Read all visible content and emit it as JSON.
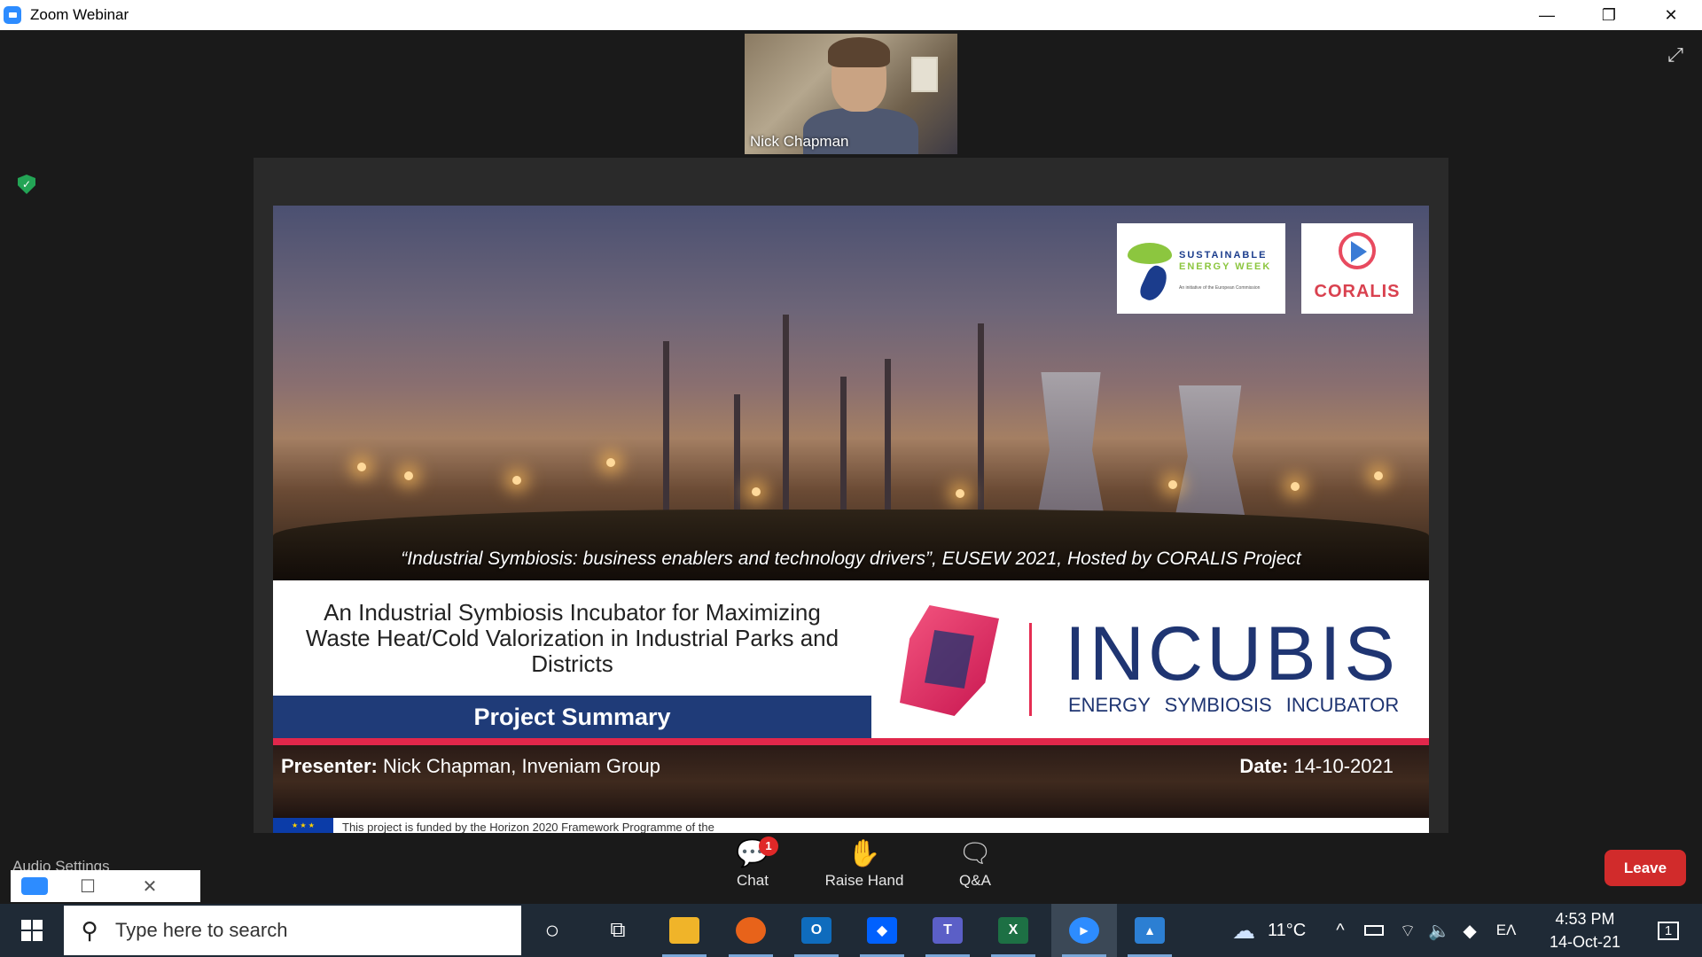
{
  "window": {
    "title": "Zoom Webinar",
    "controls": {
      "minimize": "—",
      "restore": "❐",
      "close": "✕"
    }
  },
  "participant": {
    "name": "Nick Chapman"
  },
  "icons": {
    "expand": "⤢",
    "shield": "✓"
  },
  "slide": {
    "logos": {
      "eusew_line1": "SUSTAINABLE",
      "eusew_line2": "ENERGY WEEK",
      "eusew_small": "An initiative of the European Commission",
      "coralis": "CORALIS"
    },
    "caption": "“Industrial Symbiosis: business enablers and technology drivers”, EUSEW 2021, Hosted by CORALIS Project",
    "title": "An Industrial Symbiosis Incubator for Maximizing Waste Heat/Cold Valorization in Industrial Parks and Districts",
    "summary": "Project Summary",
    "brand_name": "INCUBIS",
    "brand_tagline": "ENERGY SYMBIOSIS INCUBATOR",
    "presenter_label": "Presenter:",
    "presenter_value": "Nick Chapman, Inveniam Group",
    "date_label": "Date:",
    "date_value": "14-10-2021",
    "funding_text": "This project is funded by the Horizon 2020  Framework Programme of the"
  },
  "controls": {
    "audio_settings": "Audio Settings",
    "chat": {
      "label": "Chat",
      "badge": "1",
      "icon": "💬"
    },
    "raise_hand": {
      "label": "Raise Hand",
      "icon": "✋"
    },
    "qa": {
      "label": "Q&A",
      "icon": "🗨"
    },
    "leave": "Leave"
  },
  "mini_window": {
    "restore": "☐",
    "close": "✕"
  },
  "taskbar": {
    "search_placeholder": "Type here to search",
    "search_icon": "⚲",
    "apps": [
      {
        "name": "cortana",
        "glyph": "○"
      },
      {
        "name": "task-view",
        "glyph": "⧉"
      },
      {
        "name": "file-explorer",
        "glyph": "📁"
      },
      {
        "name": "firefox",
        "glyph": "🦊"
      },
      {
        "name": "outlook",
        "glyph": "O"
      },
      {
        "name": "dropbox",
        "glyph": "◆"
      },
      {
        "name": "teams",
        "glyph": "T"
      },
      {
        "name": "excel",
        "glyph": "X"
      },
      {
        "name": "zoom",
        "glyph": "▶"
      },
      {
        "name": "photos",
        "glyph": "▲"
      }
    ],
    "weather_icon": "☁",
    "temperature": "11°C",
    "tray_chevron": "^",
    "language": "EΛ",
    "time": "4:53 PM",
    "date": "14-Oct-21",
    "notification_count": "1"
  },
  "colors": {
    "leave": "#d12b2b",
    "summary_bar": "#1f3b78",
    "accent_red": "#e1274b",
    "incubis_blue": "#1f3572"
  }
}
